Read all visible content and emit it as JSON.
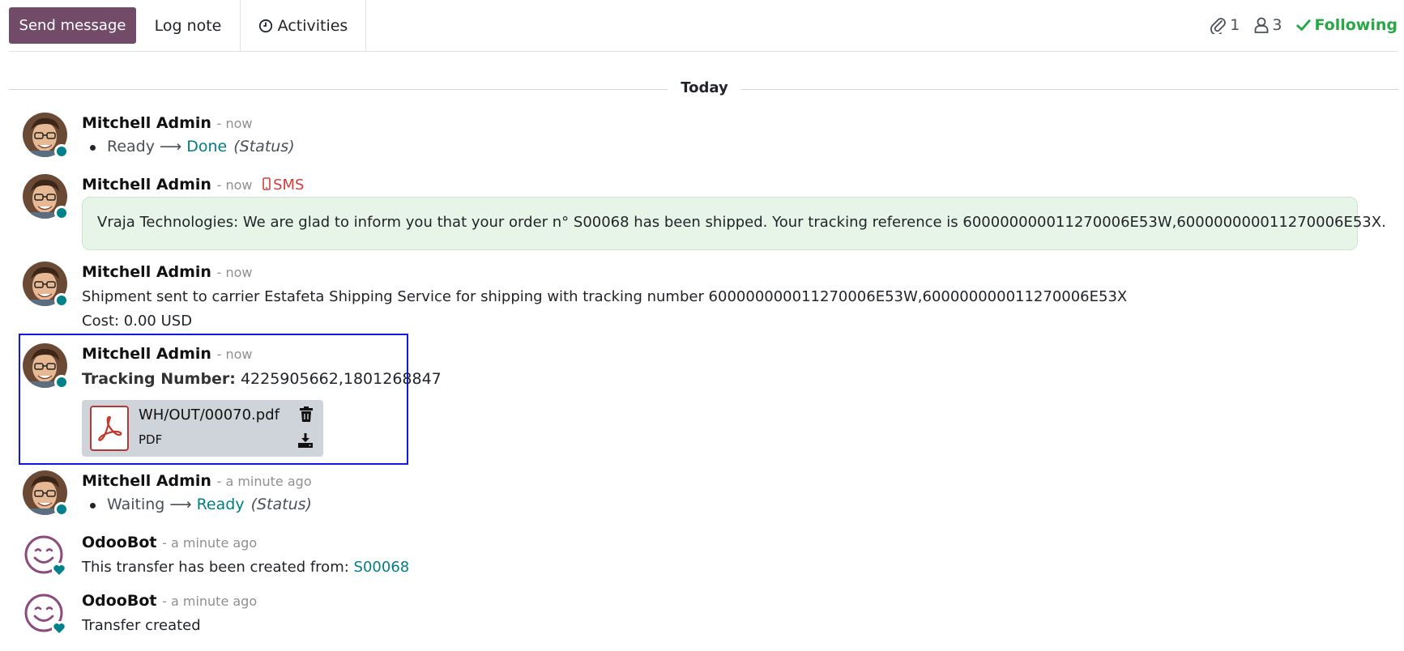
{
  "topbar": {
    "send_message": "Send message",
    "log_note": "Log note",
    "activities": "Activities",
    "attachments_count": "1",
    "followers_count": "3",
    "following": "Following"
  },
  "separator": {
    "label": "Today"
  },
  "messages": [
    {
      "author": "Mitchell Admin",
      "date": "- now",
      "tracking": {
        "old": "Ready",
        "new": "Done",
        "field": "(Status)"
      }
    },
    {
      "author": "Mitchell Admin",
      "date": "- now",
      "type_label": "SMS",
      "body": "Vraja Technologies: We are glad to inform you that your order n° S00068 has been shipped. Your tracking reference is 600000000011270006E53W,600000000011270006E53X."
    },
    {
      "author": "Mitchell Admin",
      "date": "- now",
      "body_line1": "Shipment sent to carrier Estafeta Shipping Service for shipping with tracking number 600000000011270006E53W,600000000011270006E53X",
      "body_line2": "Cost: 0.00 USD"
    },
    {
      "author": "Mitchell Admin",
      "date": "- now",
      "tracking_label": "Tracking Number:",
      "tracking_value": "4225905662,1801268847",
      "attachment": {
        "name": "WH/OUT/00070.pdf",
        "type": "PDF"
      }
    },
    {
      "author": "Mitchell Admin",
      "date": "- a minute ago",
      "tracking": {
        "old": "Waiting",
        "new": "Ready",
        "field": "(Status)"
      }
    },
    {
      "author": "OdooBot",
      "date": "- a minute ago",
      "body_prefix": "This transfer has been created from:",
      "body_link": "S00068"
    },
    {
      "author": "OdooBot",
      "date": "- a minute ago",
      "body": "Transfer created"
    }
  ],
  "colors": {
    "primary": "#714b67",
    "following": "#28a745",
    "link": "#017e84",
    "sms": "#d63b3b",
    "sms_bubble": "#e7f5e9",
    "highlight": "#1218e3",
    "presence": "#01818b"
  }
}
